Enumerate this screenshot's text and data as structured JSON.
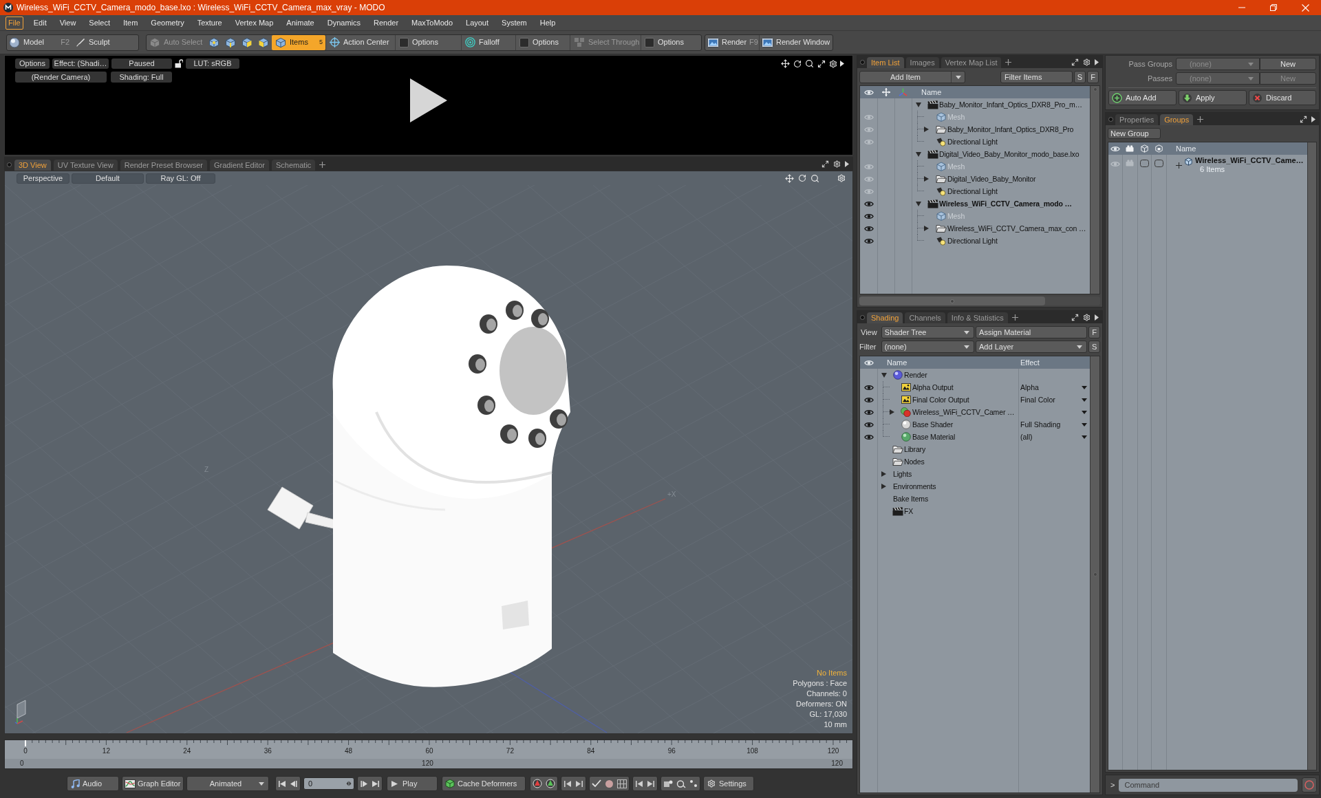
{
  "window": {
    "title": "Wireless_WiFi_CCTV_Camera_modo_base.lxo : Wireless_WiFi_CCTV_Camera_max_vray - MODO"
  },
  "menu": [
    {
      "label": "File",
      "selected": true
    },
    {
      "label": "Edit",
      "selected": false
    },
    {
      "label": "View",
      "selected": false
    },
    {
      "label": "Select",
      "selected": false
    },
    {
      "label": "Item",
      "selected": false
    },
    {
      "label": "Geometry",
      "selected": false
    },
    {
      "label": "Texture",
      "selected": false
    },
    {
      "label": "Vertex Map",
      "selected": false
    },
    {
      "label": "Animate",
      "selected": false
    },
    {
      "label": "Dynamics",
      "selected": false
    },
    {
      "label": "Render",
      "selected": false
    },
    {
      "label": "MaxToModo",
      "selected": false
    },
    {
      "label": "Layout",
      "selected": false
    },
    {
      "label": "System",
      "selected": false
    },
    {
      "label": "Help",
      "selected": false
    }
  ],
  "toolbar": {
    "modes": [
      {
        "label": "Model",
        "shortcut": "F2"
      },
      {
        "label": "Sculpt"
      }
    ],
    "auto_select": {
      "label": "Auto Select",
      "disabled": true
    },
    "selection_modes": [
      {
        "selected": false
      },
      {
        "selected": false
      },
      {
        "selected": false
      },
      {
        "selected": false
      },
      {
        "label": "Items",
        "count": "5",
        "selected": true
      }
    ],
    "tools": [
      {
        "kind": "tool",
        "label": "Action Center",
        "disabled": false
      },
      {
        "kind": "option",
        "label": "Options",
        "disabled": false
      },
      {
        "kind": "tool",
        "label": "Falloff",
        "disabled": false
      },
      {
        "kind": "option",
        "label": "Options",
        "disabled": false
      },
      {
        "kind": "tool",
        "label": "Select Through",
        "disabled": true
      },
      {
        "kind": "option",
        "label": "Options",
        "disabled": false
      }
    ],
    "render": [
      {
        "label": "Render",
        "shortcut": "F9"
      },
      {
        "label": "Render Window"
      }
    ]
  },
  "render_preview": {
    "options": "Options",
    "effect": "Effect: (Shadi…",
    "state": "Paused",
    "lut": "LUT: sRGB",
    "camera": "(Render Camera)",
    "shading": "Shading: Full"
  },
  "viewport_tabs": [
    {
      "label": "3D View",
      "selected": true
    },
    {
      "label": "UV Texture View",
      "selected": false
    },
    {
      "label": "Render Preset Browser",
      "selected": false
    },
    {
      "label": "Gradient Editor",
      "selected": false
    },
    {
      "label": "Schematic",
      "selected": false
    }
  ],
  "viewport": {
    "view_buttons": [
      "Perspective",
      "Default",
      "Ray GL: Off"
    ],
    "grid_labels": [
      "Z",
      "+X"
    ],
    "selection_status": "No Items",
    "stats": [
      "Polygons : Face",
      "Channels: 0",
      "Deformers: ON",
      "GL: 17,030",
      "10 mm"
    ]
  },
  "timeline": {
    "ticks": [
      "0",
      "12",
      "24",
      "36",
      "48",
      "60",
      "72",
      "84",
      "96",
      "108",
      "120"
    ],
    "range": [
      "0",
      "120",
      "120"
    ]
  },
  "playback": {
    "audio": "Audio",
    "graph_editor": "Graph Editor",
    "key_mode": "Animated",
    "frame": "0",
    "play": "Play",
    "cache": "Cache Deformers",
    "settings": "Settings"
  },
  "item_list": {
    "tabs": [
      {
        "label": "Item List",
        "selected": true
      },
      {
        "label": "Images",
        "selected": false
      },
      {
        "label": "Vertex Map List",
        "selected": false
      }
    ],
    "add_item": "Add Item",
    "filter": {
      "placeholder": "Filter Items"
    },
    "filter_buttons": [
      "S",
      "F"
    ],
    "column": "Name",
    "items": [
      {
        "name": "Baby_Monitor_Infant_Optics_DXR8_Pro_m…",
        "kind": "scene",
        "current": false,
        "expanded": true,
        "children": [
          {
            "name": "Mesh",
            "kind": "mesh",
            "visible": false
          },
          {
            "name": "Baby_Monitor_Infant_Optics_DXR8_Pro",
            "kind": "group",
            "visible": false,
            "expanded": false
          },
          {
            "name": "Directional Light",
            "kind": "light",
            "visible": false
          }
        ]
      },
      {
        "name": "Digital_Video_Baby_Monitor_modo_base.lxo",
        "kind": "scene",
        "current": false,
        "expanded": true,
        "children": [
          {
            "name": "Mesh",
            "kind": "mesh",
            "visible": false
          },
          {
            "name": "Digital_Video_Baby_Monitor",
            "kind": "group",
            "visible": false,
            "expanded": false
          },
          {
            "name": "Directional Light",
            "kind": "light",
            "visible": false
          }
        ]
      },
      {
        "name": "Wireless_WiFi_CCTV_Camera_modo …",
        "kind": "scene",
        "current": true,
        "expanded": true,
        "visible": true,
        "children": [
          {
            "name": "Mesh",
            "kind": "mesh",
            "visible": true
          },
          {
            "name": "Wireless_WiFi_CCTV_Camera_max_con …",
            "kind": "group",
            "visible": true,
            "expanded": false
          },
          {
            "name": "Directional Light",
            "kind": "light",
            "visible": true
          }
        ]
      }
    ]
  },
  "shading": {
    "tabs": [
      {
        "label": "Shading",
        "selected": true
      },
      {
        "label": "Channels",
        "selected": false
      },
      {
        "label": "Info & Statistics",
        "selected": false
      }
    ],
    "view_label": "View",
    "view": "Shader Tree",
    "assign": "Assign Material",
    "assign_button": "F",
    "filter_label": "Filter",
    "filter": "(none)",
    "add_layer": "Add Layer",
    "add_layer_button": "S",
    "columns": [
      "Name",
      "Effect"
    ],
    "layers": [
      {
        "name": "Render",
        "kind": "render",
        "expanded": true,
        "children": [
          {
            "name": "Alpha Output",
            "kind": "output",
            "visible": true,
            "effect": "Alpha"
          },
          {
            "name": "Final Color Output",
            "kind": "output",
            "visible": true,
            "effect": "Final Color"
          },
          {
            "name": "Wireless_WiFi_CCTV_Camer …",
            "kind": "material_group",
            "visible": true,
            "expanded": false
          },
          {
            "name": "Base Shader",
            "kind": "shader",
            "visible": true,
            "effect": "Full Shading"
          },
          {
            "name": "Base Material",
            "kind": "material",
            "visible": true,
            "effect": "(all)"
          }
        ]
      },
      {
        "name": "Library",
        "kind": "folder"
      },
      {
        "name": "Nodes",
        "kind": "folder"
      },
      {
        "name": "Lights",
        "kind": "plain",
        "expanded": false
      },
      {
        "name": "Environments",
        "kind": "plain",
        "expanded": false
      },
      {
        "name": "Bake Items",
        "kind": "plain"
      },
      {
        "name": "FX",
        "kind": "fx"
      }
    ]
  },
  "passes": {
    "rows": [
      {
        "label": "Pass Groups",
        "value": "(none)",
        "button": "New",
        "disabled": false
      },
      {
        "label": "Passes",
        "value": "(none)",
        "button": "New",
        "disabled": true
      }
    ],
    "actions": [
      "Auto Add",
      "Apply",
      "Discard"
    ]
  },
  "groups": {
    "tabs": [
      {
        "label": "Properties",
        "selected": false
      },
      {
        "label": "Groups",
        "selected": true
      }
    ],
    "new_group": "New Group",
    "column": "Name",
    "items": [
      {
        "name": "Wireless_WiFi_CCTV_Came…",
        "count": "6 Items",
        "expanded": false
      }
    ]
  },
  "command": {
    "prompt": ">",
    "placeholder": "Command"
  }
}
